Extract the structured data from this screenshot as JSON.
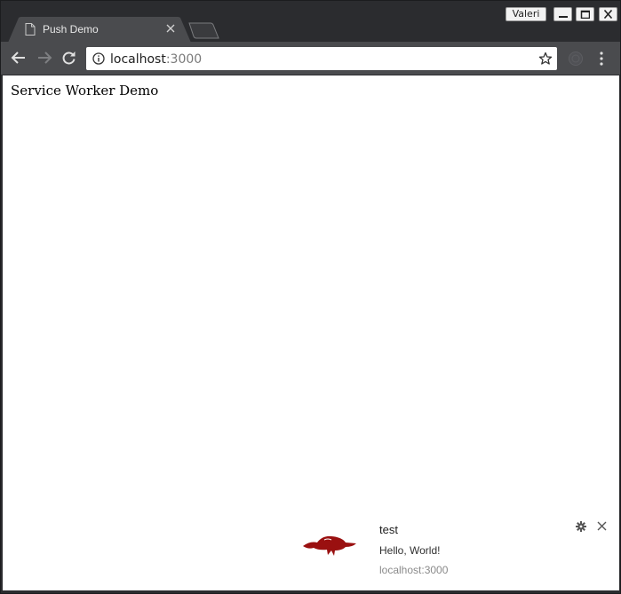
{
  "window": {
    "profile_name": "Valeri",
    "controls": {
      "minimize": "minimize-icon",
      "maximize": "maximize-icon",
      "close": "close-icon"
    }
  },
  "tabs": [
    {
      "title": "Push Demo",
      "icon": "page-icon",
      "active": true
    }
  ],
  "toolbar": {
    "url_host": "localhost",
    "url_port": ":3000",
    "icons": [
      "back-arrow-icon",
      "forward-arrow-icon",
      "reload-icon",
      "info-icon",
      "star-icon",
      "extension-icon",
      "menu-icon"
    ]
  },
  "page": {
    "heading": "Service Worker Demo"
  },
  "notification": {
    "title": "test",
    "body": "Hello, World!",
    "origin": "localhost:3000",
    "logo_color": "#9a1010"
  },
  "colors": {
    "frame": "#2b2c2f",
    "toolbar": "#4a4b4e",
    "active_tab": "#4a4b4e",
    "accent_logo": "#9a1010"
  }
}
